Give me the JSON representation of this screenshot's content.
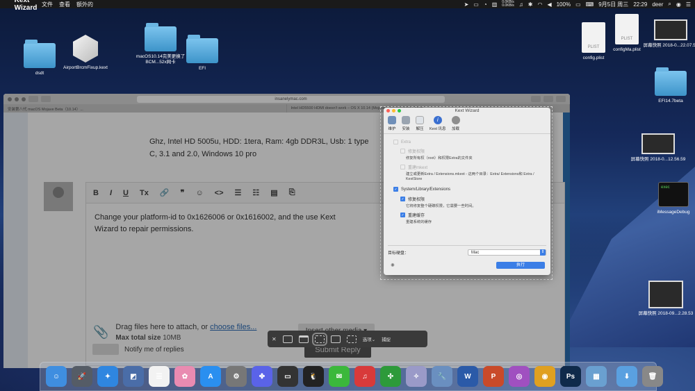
{
  "menubar": {
    "app_name": "Kext Wizard",
    "menus": [
      "文件",
      "查看",
      "额外的"
    ],
    "net_up": "0.0KB/s",
    "net_down": "0.0KB/s",
    "battery": "100%",
    "date": "9月5日 周三",
    "time": "22:29",
    "user": "deer"
  },
  "desktop": {
    "icons_left": [
      {
        "label": "dsdt",
        "kind": "folder"
      },
      {
        "label": "AirportBrcmFixup.kext",
        "kind": "kext"
      },
      {
        "label": "macOS10.14完美更换了BCM...52x网卡",
        "kind": "folder"
      },
      {
        "label": "EFI",
        "kind": "folder"
      }
    ],
    "icons_right": [
      {
        "label": "config.plist",
        "kind": "plist"
      },
      {
        "label": "configMa.plist",
        "kind": "plist"
      },
      {
        "label": "屏幕快照 2018-0...22.07.55",
        "kind": "shot"
      },
      {
        "label": "EFI14.7beta",
        "kind": "folder"
      },
      {
        "label": "屏幕快照 2018-0...12.56.59",
        "kind": "shot"
      },
      {
        "label": "iMessageDebug",
        "kind": "term"
      },
      {
        "label": "屏幕快照 2018-09...2.28.53",
        "kind": "shot"
      }
    ],
    "plist_badge": "PLIST",
    "term_text": "exec"
  },
  "browser": {
    "url": "insanelymac.com",
    "tabs": [
      "安装第八代 macOS Mojave Beta（10.14）...",
      "Intel HD5500 HDMI doesn't work – OS X 10.14 (Mojave) - InsanelyMac Forum"
    ],
    "post_text": "Ghz, Intel HD 5005u, HDD: 1tera, Ram: 4gb DDR3L, Usb: 1 type C, 3.1 and 2.0, Windows 10 pro",
    "editor_tools": [
      "B",
      "I",
      "U",
      "Tx",
      "🔗",
      "❞",
      "☺",
      "<>",
      "☰",
      "☷",
      "▤",
      "⎘"
    ],
    "reply_text": "Change your platform-id to 0x1626006 or 0x1616002, and the use Kext Wizard to repair permissions.",
    "attach_text": "Drag files here to attach, or ",
    "attach_link": "choose files...",
    "max_size_label": "Max total size",
    "max_size_value": "10MB",
    "insert_media": "Insert other media ▾",
    "notify": "Notify me of replies",
    "submit": "Submit Reply"
  },
  "kext_wizard": {
    "title": "Kext Wizard",
    "tabs": [
      {
        "label": "维护",
        "color": "#6f8fb8"
      },
      {
        "label": "安装",
        "color": "#9aa4b0"
      },
      {
        "label": "解压",
        "color": "#dfe3e8"
      },
      {
        "label": "Kext 讯息",
        "color": "#3a6fd0"
      },
      {
        "label": "加载",
        "color": "#8e8e8e"
      }
    ],
    "extra": "Extra",
    "repair_extra": "修复权限",
    "repair_extra_desc": "修复所有权（root）和权限Extra的文件夹",
    "rebuild_mkext": "重建mkext",
    "rebuild_mkext_desc": "建立或更新Extra / Extensions.mkext - 这两个目录：Extra/ Extensions和 Extra / KextStore",
    "sle": "System/Library/Extensions",
    "repair_sle": "修复权限",
    "repair_sle_desc": "它将修复整个硬碟权限，它需要一些时间。",
    "rebuild_cache": "重建缓存",
    "rebuild_cache_desc": "重建系统的缓存",
    "target_disk_label": "目标硬盘：",
    "target_disk": "Mac",
    "run": "执行"
  },
  "screenshot_toolbar": {
    "options": "选项⌄",
    "capture": "捕捉"
  },
  "dock": {
    "apps": [
      {
        "name": "finder-app",
        "color": "#3f8ee0",
        "glyph": "☺"
      },
      {
        "name": "launchpad-app",
        "color": "#555c66",
        "glyph": "🚀"
      },
      {
        "name": "safari-app",
        "color": "#2f86e0",
        "glyph": "✦"
      },
      {
        "name": "preview-app",
        "color": "#4a6da8",
        "glyph": "◩"
      },
      {
        "name": "reminders-app",
        "color": "#f2f2f2",
        "glyph": "☰"
      },
      {
        "name": "photos-app",
        "color": "#e98bb1",
        "glyph": "✿"
      },
      {
        "name": "appstore-app",
        "color": "#2a8ff0",
        "glyph": "A"
      },
      {
        "name": "sysprefs-app",
        "color": "#777",
        "glyph": "⚙"
      },
      {
        "name": "baidu-app",
        "color": "#5a63e8",
        "glyph": "✤"
      },
      {
        "name": "screen-app",
        "color": "#333",
        "glyph": "▭"
      },
      {
        "name": "qq-app",
        "color": "#222",
        "glyph": "🐧"
      },
      {
        "name": "wechat-app",
        "color": "#3bb83b",
        "glyph": "✉"
      },
      {
        "name": "netease-music-app",
        "color": "#d83a3a",
        "glyph": "♫"
      },
      {
        "name": "clover-app",
        "color": "#2d9a3a",
        "glyph": "✣"
      },
      {
        "name": "kext-app",
        "color": "#9a9ac8",
        "glyph": "✧"
      },
      {
        "name": "kextwizard-app",
        "color": "#6a8fc0",
        "glyph": "🔧"
      },
      {
        "name": "word-app",
        "color": "#2b5aa8",
        "glyph": "W"
      },
      {
        "name": "powerpoint-app",
        "color": "#c94a2a",
        "glyph": "P"
      },
      {
        "name": "remote-app",
        "color": "#a050c0",
        "glyph": "◎"
      },
      {
        "name": "chrome-app",
        "color": "#e0a020",
        "glyph": "◉"
      },
      {
        "name": "photoshop-app",
        "color": "#0f2a4a",
        "glyph": "Ps"
      },
      {
        "name": "image-app",
        "color": "#6aa0d0",
        "glyph": "▦"
      },
      {
        "name": "downloads-app",
        "color": "#5aa0e0",
        "glyph": "⬇"
      },
      {
        "name": "trash-app",
        "color": "#888",
        "glyph": "🗑"
      }
    ]
  }
}
